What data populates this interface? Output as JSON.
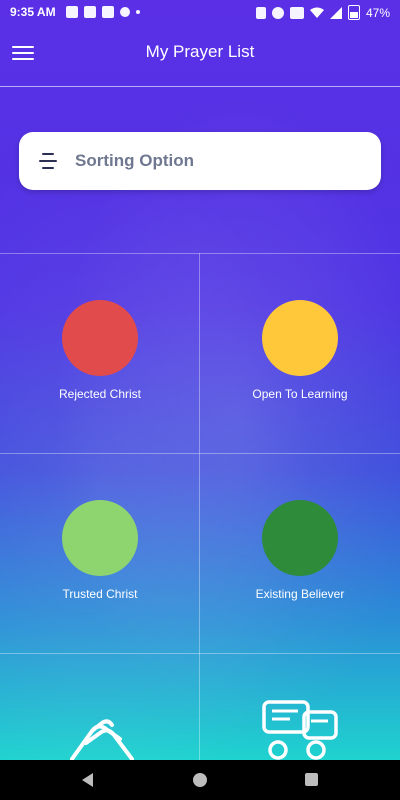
{
  "status_bar": {
    "time": "9:35 AM",
    "battery": "47%",
    "icons": [
      "notification-icon",
      "vpn-icon",
      "news-icon",
      "app-icon",
      "dot-icon",
      "vibrate-icon",
      "alarm-icon",
      "volte-icon",
      "wifi-icon",
      "signal-icon",
      "battery-icon"
    ]
  },
  "app_bar": {
    "title": "My Prayer List",
    "menu_icon": "hamburger-menu-icon"
  },
  "sorting": {
    "label": "Sorting Option",
    "icon": "sort-lines-icon"
  },
  "categories": [
    {
      "label": "Rejected Christ",
      "color": "#e24b4b"
    },
    {
      "label": "Open To Learning",
      "color": "#ffc83a"
    },
    {
      "label": "Trusted Christ",
      "color": "#8ed56f"
    },
    {
      "label": "Existing Believer",
      "color": "#2e8b3a"
    }
  ],
  "bottom_tiles": [
    {
      "icon": "handshake-icon"
    },
    {
      "icon": "chat-bubbles-icon"
    }
  ],
  "nav_bar": {
    "icons": [
      "back-triangle-icon",
      "home-circle-icon",
      "recent-square-icon"
    ]
  }
}
